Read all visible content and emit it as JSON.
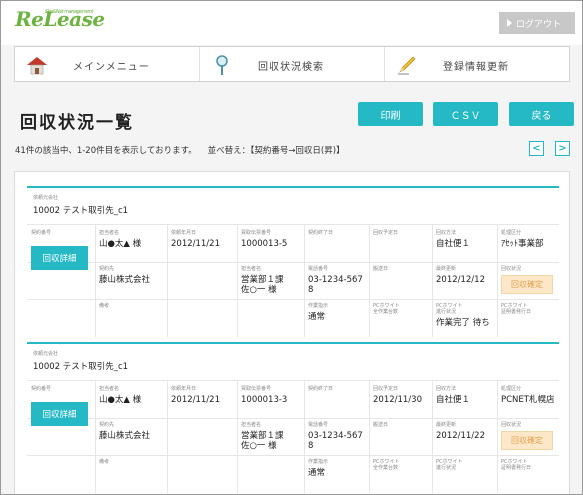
{
  "header": {
    "logo_text": "ReLease",
    "logo_tag": "Sky&Net management",
    "logout_label": "ログアウト"
  },
  "nav": {
    "items": [
      {
        "label": "メインメニュー",
        "icon": "house-icon"
      },
      {
        "label": "回収状況検索",
        "icon": "magnifier-pin-icon"
      },
      {
        "label": "登録情報更新",
        "icon": "pencil-icon"
      }
    ]
  },
  "page": {
    "title": "回収状況一覧",
    "print_label": "印刷",
    "csv_label": "ＣＳＶ",
    "back_label": "戻る",
    "result_info": "41件の該当中、1-20件目を表示しております。",
    "sort_info": "並べ替え：【契約番号→回収日(昇)】",
    "prev_label": "<",
    "next_label": ">"
  },
  "labels": {
    "client": "依頼元会社",
    "contract_no": "契約番号",
    "detail_button": "回収詳細",
    "person": "担当者名",
    "request_date": "依頼年月日",
    "voucher_no": "買取伝票番号",
    "end_date": "契約終了日",
    "collect_date": "回収予定日",
    "method": "回収方法",
    "category": "処理区分",
    "dest": "契約先",
    "dest_person": "担当者名",
    "phone": "電話番号",
    "pickup": "搬送日",
    "update": "最終更新",
    "status": "回収状況",
    "remarks": "備考",
    "instruction": "作業指示",
    "pc_white_l1": "PCホワイト",
    "pc_white_l2": "全作業台数",
    "pc_white_prog1": "PCホワイト",
    "pc_white_prog2": "進行状況",
    "pc_cert1": "PCホワイト",
    "pc_cert2": "証明書発行日"
  },
  "records": [
    {
      "client": "10002 テスト取引先_c1",
      "person": "山●太▲ 様",
      "request_date": "2012/11/21",
      "voucher_no": "1000013-5",
      "end_date": "",
      "collect_date": "",
      "method": "自社便１",
      "category": "ｱｾｯﾄ事業部",
      "dest": "藤山株式会社",
      "dest_person_l1": "営業部１課",
      "dest_person_l2": "佐○一 様",
      "phone_l1": "03-1234-567",
      "phone_l2": "8",
      "pickup": "",
      "update": "2012/12/12",
      "status": "回収確定",
      "instruction": "通常",
      "pc_white_count": "",
      "pc_white_status": "作業完了 待ち",
      "pc_cert": ""
    },
    {
      "client": "10002 テスト取引先_c1",
      "person": "山●太▲ 様",
      "request_date": "2012/11/21",
      "voucher_no": "1000013-3",
      "end_date": "",
      "collect_date": "2012/11/30",
      "method": "自社便１",
      "category": "PCNET札幌店",
      "dest": "藤山株式会社",
      "dest_person_l1": "営業部１課",
      "dest_person_l2": "佐○一 様",
      "phone_l1": "03-1234-567",
      "phone_l2": "8",
      "pickup": "",
      "update": "2012/11/22",
      "status": "回収確定",
      "instruction": "通常",
      "pc_white_count": "",
      "pc_white_status": "",
      "pc_cert": ""
    }
  ],
  "colors": {
    "accent": "#25b8c5",
    "logo": "#6db33f",
    "status_bg": "#fce8c8",
    "status_text": "#e0a050"
  }
}
